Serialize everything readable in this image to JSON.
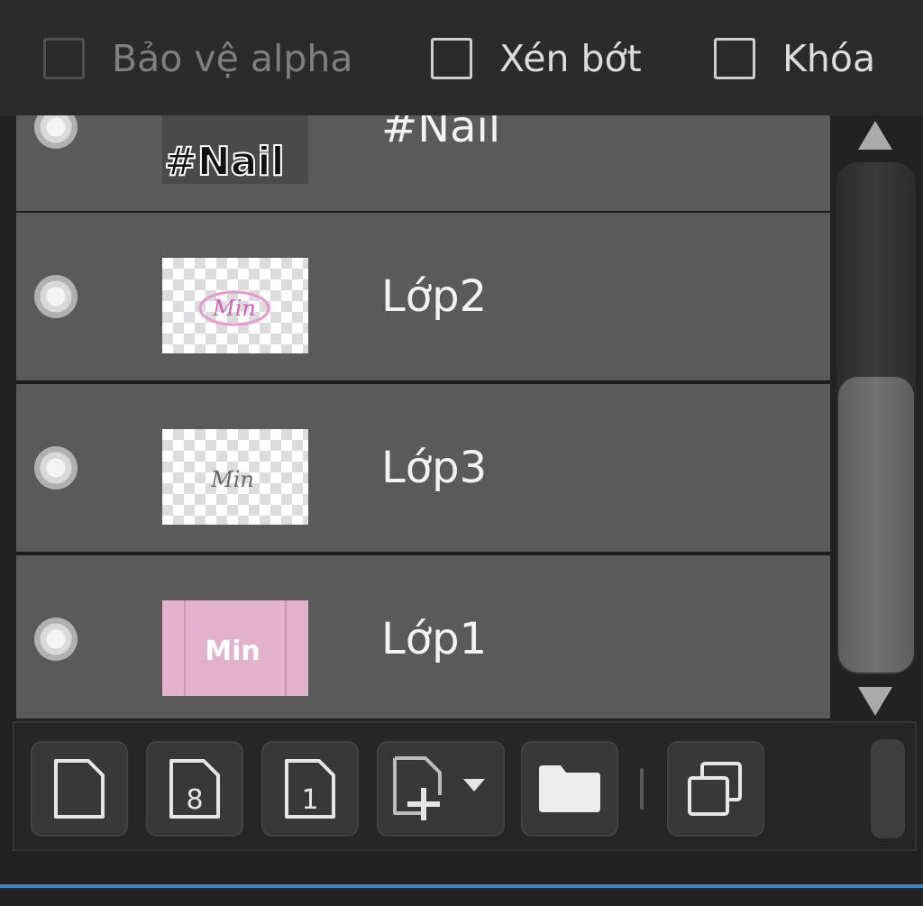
{
  "options": [
    {
      "label": "Bảo vệ alpha",
      "checked": false,
      "enabled": false
    },
    {
      "label": "Xén bớt",
      "checked": false,
      "enabled": true
    },
    {
      "label": "Khóa",
      "checked": false,
      "enabled": true
    }
  ],
  "layers": [
    {
      "name": "#Nail",
      "visible": true,
      "thumb": "text"
    },
    {
      "name": "Lớp2",
      "visible": true,
      "thumb": "checker-pink"
    },
    {
      "name": "Lớp3",
      "visible": true,
      "thumb": "checker-gray"
    },
    {
      "name": "Lớp1",
      "visible": true,
      "thumb": "pink"
    }
  ],
  "thumb_texts": {
    "nail": "#Nail",
    "min": "Min"
  },
  "scrollbar": {
    "up": "▲",
    "down": "▼",
    "position_fraction": 1.0
  },
  "toolbar": {
    "buttons": [
      {
        "icon": "new-layer-icon"
      },
      {
        "icon": "new-8bit-layer-icon",
        "glyph": "8"
      },
      {
        "icon": "new-1bit-layer-icon",
        "glyph": "1"
      },
      {
        "icon": "add-layer-dropdown-icon"
      },
      {
        "icon": "folder-icon"
      },
      {
        "icon": "duplicate-layer-icon"
      }
    ]
  },
  "colors": {
    "accent": "#3d86c6",
    "row": "#5a5a5a",
    "thumb_pink": "#e2b2cc"
  }
}
